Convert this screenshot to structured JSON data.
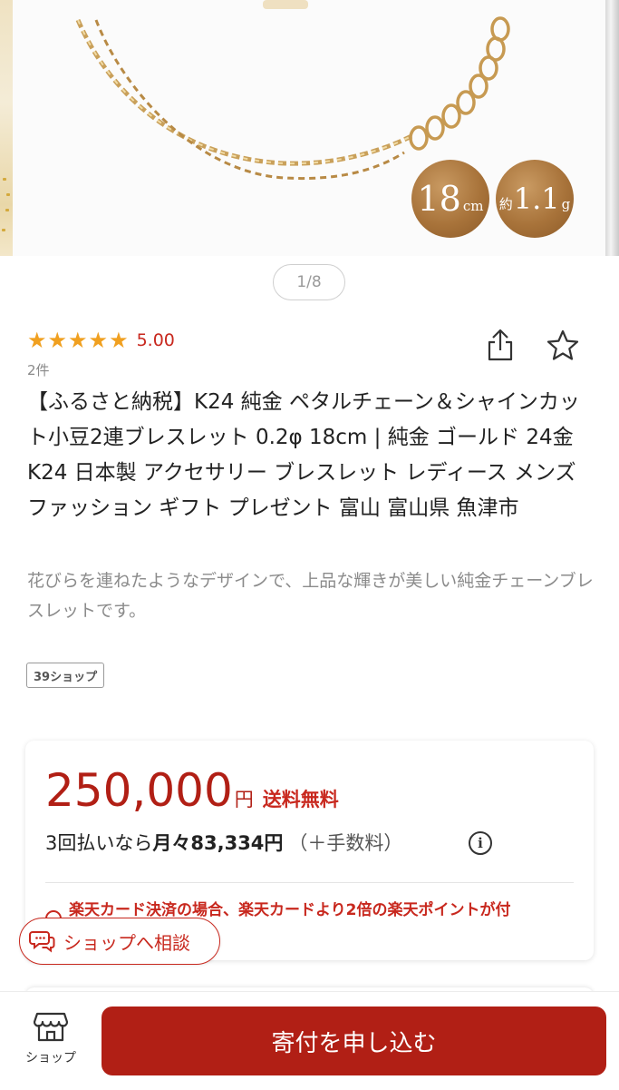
{
  "gallery": {
    "badge_length_value": "18",
    "badge_length_unit": "cm",
    "badge_weight_prefix": "約",
    "badge_weight_value": "1.1",
    "badge_weight_unit": "g",
    "pager": "1/8"
  },
  "rating": {
    "stars": "★★★★★",
    "value": "5.00",
    "count": "2件"
  },
  "product": {
    "title": "【ふるさと納税】K24 純金 ペタルチェーン＆シャインカット小豆2連ブレスレット 0.2φ 18cm | 純金 ゴールド 24金 K24 日本製 アクセサリー ブレスレット レディース メンズ ファッション ギフト プレゼント 富山 富山県 魚津市",
    "description": "花びらを連ねたようなデザインで、上品な輝きが美しい純金チェーンブレスレットです。",
    "shop_tag": "39ショップ"
  },
  "price": {
    "amount": "250,000",
    "yen": "円",
    "shipping": "送料無料",
    "installment_prefix": "3回払いなら",
    "installment_amount": "月々83,334円",
    "installment_fee": "（＋手数料）",
    "info_glyph": "i",
    "card_notice": "楽天カード決済の場合、楽天カードより2倍の楽天ポイントが付"
  },
  "consult": {
    "label": "ショップへ相談"
  },
  "bottom_bar": {
    "shop_label": "ショップ",
    "apply_label": "寄付を申し込む"
  },
  "colors": {
    "accent_red": "#b11f15",
    "star_orange": "#f0a020",
    "badge_bronze": "#a8733a"
  },
  "icons": {
    "share": "share-icon",
    "favorite": "star-outline-icon",
    "info": "info-icon",
    "consult": "chat-bubbles-icon",
    "shop": "storefront-icon"
  }
}
